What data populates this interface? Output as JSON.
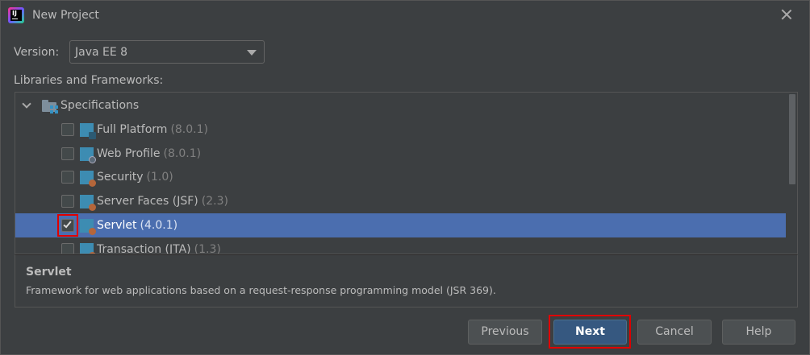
{
  "window": {
    "title": "New Project"
  },
  "version": {
    "label": "Version:",
    "selected": "Java EE 8"
  },
  "libraries": {
    "label": "Libraries and Frameworks:",
    "root": {
      "label": "Specifications",
      "expanded": true
    },
    "items": [
      {
        "label": "Full Platform",
        "version": "(8.0.1)",
        "checked": false,
        "icon": "full-platform-icon"
      },
      {
        "label": "Web Profile",
        "version": "(8.0.1)",
        "checked": false,
        "icon": "web-profile-icon"
      },
      {
        "label": "Security",
        "version": "(1.0)",
        "checked": false,
        "icon": "security-icon"
      },
      {
        "label": "Server Faces (JSF)",
        "version": "(2.3)",
        "checked": false,
        "icon": "server-faces-icon"
      },
      {
        "label": "Servlet",
        "version": "(4.0.1)",
        "checked": true,
        "selected": true,
        "icon": "servlet-icon"
      },
      {
        "label": "Transaction (JTA)",
        "version": "(1.3)",
        "checked": false,
        "icon": "transaction-icon"
      }
    ]
  },
  "description": {
    "title": "Servlet",
    "text": "Framework for web applications based on a request-response programming model (JSR 369)."
  },
  "buttons": {
    "previous": "Previous",
    "next": "Next",
    "cancel": "Cancel",
    "help": "Help"
  },
  "colors": {
    "background": "#3c3f41",
    "selection": "#4b6eaf",
    "primary_button": "#365880",
    "highlight": "#e00000"
  }
}
